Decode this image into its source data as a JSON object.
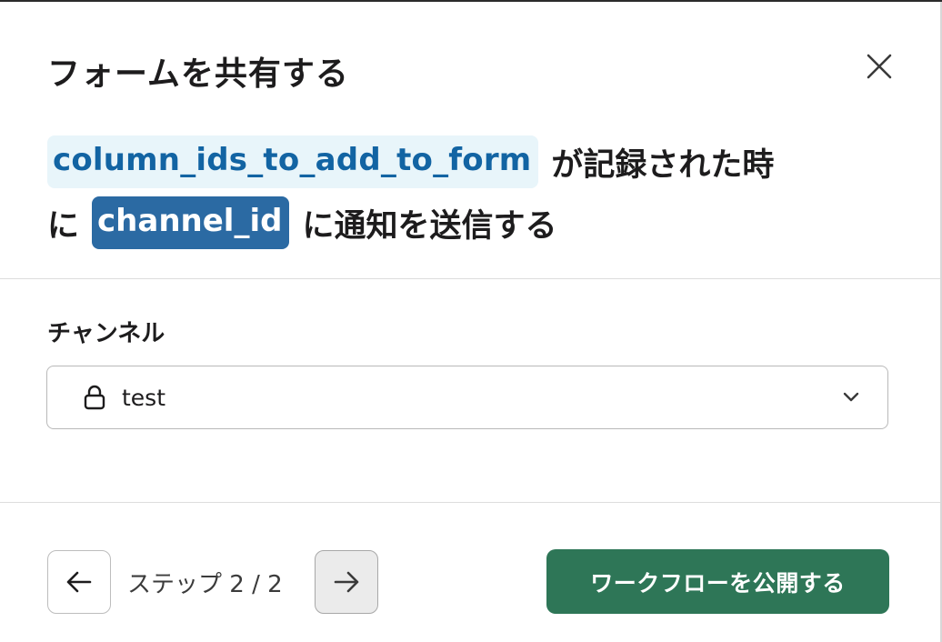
{
  "modal": {
    "title": "フォームを共有する",
    "close_icon": "close-icon"
  },
  "summary": {
    "chip_column": "column_ids_to_add_to_form",
    "text_recorded": "が記録された時",
    "text_ni": "に",
    "chip_channel": "channel_id",
    "text_notify": "に通知を送信する",
    "chip_light_bg": "#e8f5fa",
    "chip_light_fg": "#1264a3",
    "chip_dark_bg": "#2b6aa3"
  },
  "channel": {
    "label": "チャンネル",
    "selected": "test",
    "lock_icon": "lock-icon",
    "dropdown_icon": "chevron-down-icon"
  },
  "footer": {
    "prev_icon": "arrow-left-icon",
    "step_text": "ステップ 2 / 2",
    "next_icon": "arrow-right-icon",
    "publish_label": "ワークフローを公開する",
    "publish_color": "#2e7657"
  }
}
